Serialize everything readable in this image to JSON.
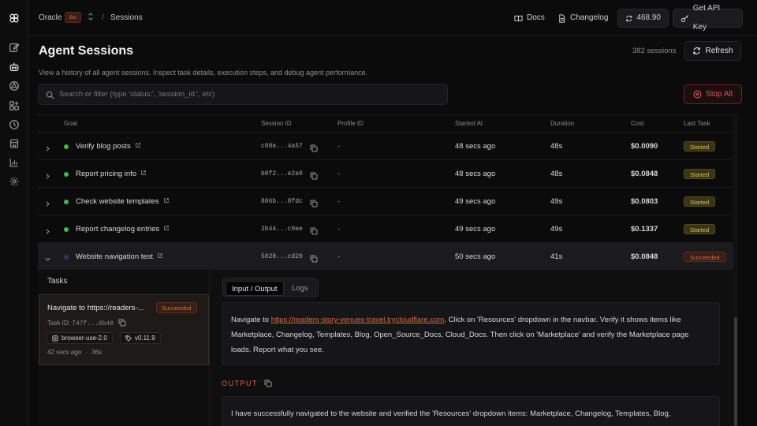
{
  "topbar": {
    "org": "Oracle",
    "org_badge": "Biz",
    "separator": "/",
    "page": "Sessions",
    "docs": "Docs",
    "changelog": "Changelog",
    "credits": "468.90",
    "api_key": "Get API Key"
  },
  "header": {
    "title": "Agent Sessions",
    "subtitle": "View a history of all agent sessions. Inspect task details, execution steps, and debug agent performance.",
    "session_count": "382 sessions",
    "refresh": "Refresh"
  },
  "search": {
    "placeholder": "Search or filter (type 'status:', 'session_id:', etc)",
    "stop_all": "Stop All"
  },
  "table": {
    "columns": [
      "Goal",
      "Session ID",
      "Profile ID",
      "Started At",
      "Duration",
      "Cost",
      "Last Task"
    ],
    "rows": [
      {
        "goal": "Verify blog posts",
        "session_id": "c88e...4a57",
        "profile_id": "-",
        "started_at": "48 secs ago",
        "duration": "48s",
        "cost": "$0.0090",
        "status": "Started",
        "dot": "#3fb950"
      },
      {
        "goal": "Report pricing info",
        "session_id": "b0f2...e2a0",
        "profile_id": "-",
        "started_at": "48 secs ago",
        "duration": "48s",
        "cost": "$0.0848",
        "status": "Started",
        "dot": "#3fb950"
      },
      {
        "goal": "Check website templates",
        "session_id": "886b...8fdc",
        "profile_id": "-",
        "started_at": "49 secs ago",
        "duration": "49s",
        "cost": "$0.0803",
        "status": "Started",
        "dot": "#3fb950"
      },
      {
        "goal": "Report changelog entries",
        "session_id": "2b44...c9ee",
        "profile_id": "-",
        "started_at": "49 secs ago",
        "duration": "49s",
        "cost": "$0.1337",
        "status": "Started",
        "dot": "#3fb950"
      },
      {
        "goal": "Website navigation test",
        "session_id": "5828...cd20",
        "profile_id": "-",
        "started_at": "50 secs ago",
        "duration": "41s",
        "cost": "$0.0848",
        "status": "Succeeded",
        "dot": "#2e3a55"
      }
    ]
  },
  "tasks": {
    "title": "Tasks",
    "item": {
      "title": "Navigate to https://readers-...",
      "badge": "Succeeded",
      "id_label": "Task ID:",
      "id_value": "747f...6b40",
      "agent": "browser-use-2.0",
      "version": "v0.11.9",
      "time": "42 secs ago",
      "dot_sep": "·",
      "duration": "36s"
    }
  },
  "detail": {
    "tab_io": "Input / Output",
    "tab_logs": "Logs",
    "input_pre": "Navigate to ",
    "input_link": "https://readers-story-venues-travel.trycloudflare.com",
    "input_post": ". Click on 'Resources' dropdown in the navbar. Verify it shows items like Marketplace, Changelog, Templates, Blog, Open_Source_Docs, Cloud_Docs. Then click on 'Marketplace' and verify the Marketplace page loads. Report what you see.",
    "output_label": "OUTPUT",
    "output_text": "I have successfully navigated to the website and verified the 'Resources' dropdown items: Marketplace, Changelog, Templates, Blog,"
  }
}
